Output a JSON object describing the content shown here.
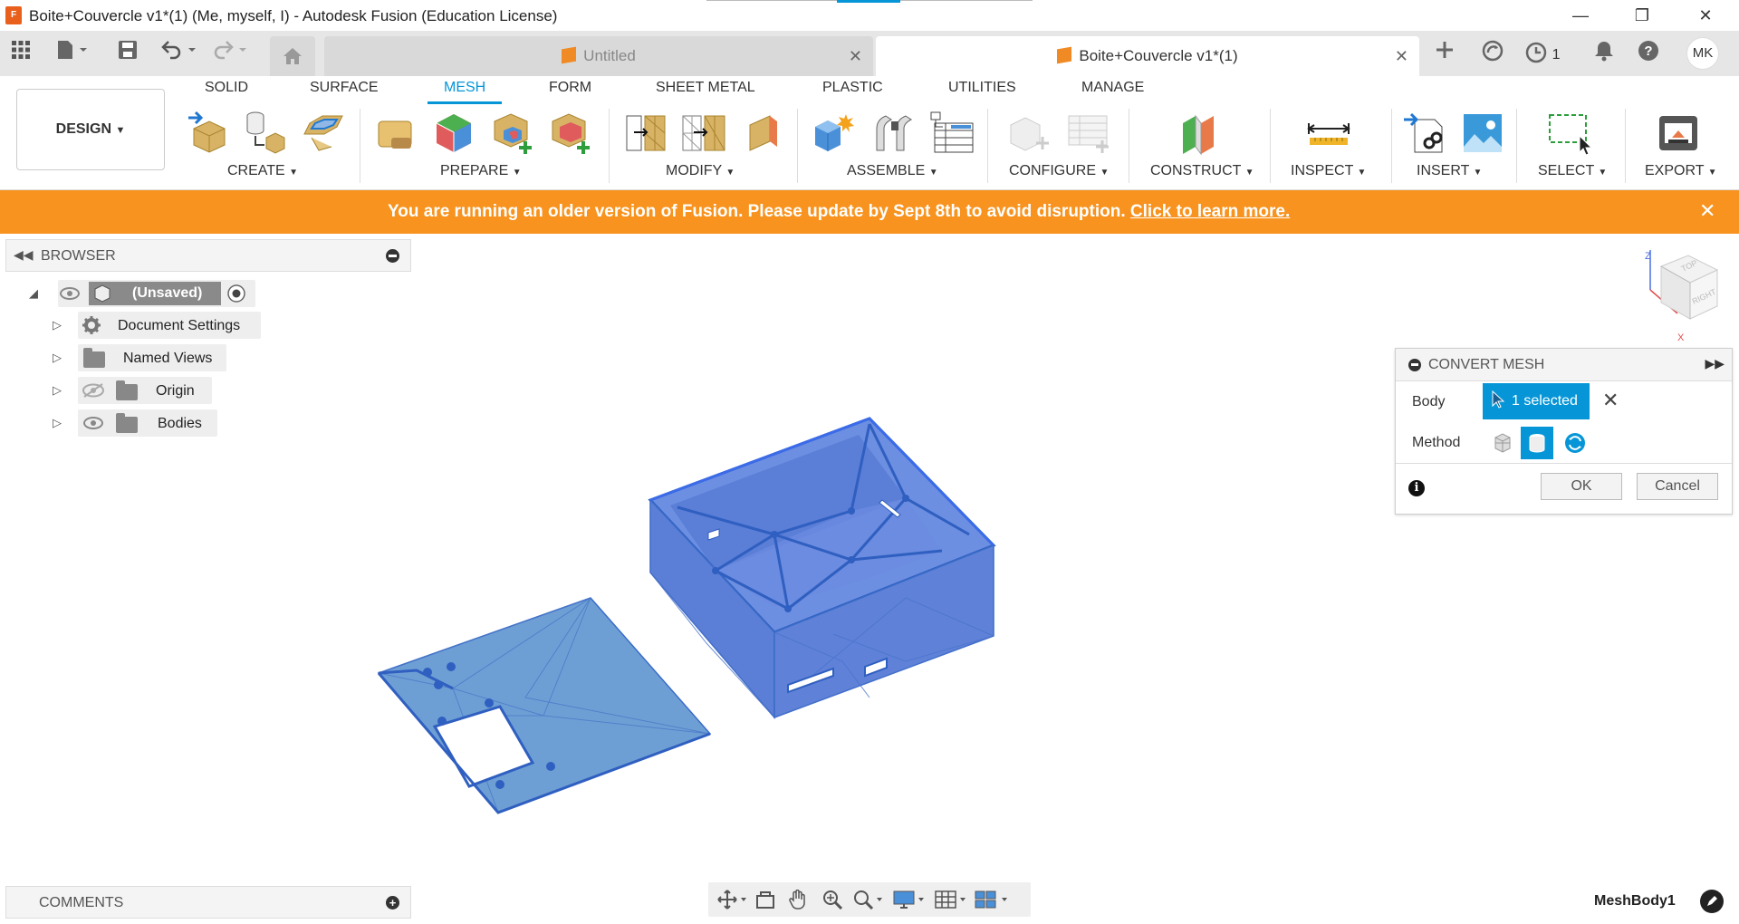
{
  "window": {
    "title": "Boite+Couvercle v1*(1) (Me, myself, I) - Autodesk Fusion (Education License)",
    "app_icon_letter": "F",
    "controls": {
      "minimize": "—",
      "restore": "❐",
      "close": "✕"
    }
  },
  "tabs": [
    {
      "label": "Untitled",
      "active": false
    },
    {
      "label": "Boite+Couvercle v1*(1)",
      "active": true
    }
  ],
  "tabbar_right": {
    "jobs_count": "1",
    "user_initials": "MK"
  },
  "workspace": {
    "mode_label": "DESIGN",
    "tabs": [
      "SOLID",
      "SURFACE",
      "MESH",
      "FORM",
      "SHEET METAL",
      "PLASTIC",
      "UTILITIES",
      "MANAGE"
    ],
    "active_tab": "MESH",
    "groups": [
      "CREATE",
      "PREPARE",
      "MODIFY",
      "ASSEMBLE",
      "CONFIGURE",
      "CONSTRUCT",
      "INSPECT",
      "INSERT",
      "SELECT",
      "EXPORT"
    ]
  },
  "banner": {
    "text": "You are running an older version of Fusion. Please update by Sept 8th to avoid disruption.",
    "link": "Click to learn more.",
    "color": "#f7931e"
  },
  "browser": {
    "title": "BROWSER",
    "root": "(Unsaved)",
    "items": [
      "Document Settings",
      "Named Views",
      "Origin",
      "Bodies"
    ]
  },
  "comments": {
    "title": "COMMENTS"
  },
  "convert_mesh": {
    "title": "CONVERT MESH",
    "body_label": "Body",
    "body_value": "1 selected",
    "method_label": "Method",
    "ok": "OK",
    "cancel": "Cancel"
  },
  "viewcube": {
    "top": "TOP",
    "right": "RIGHT",
    "axis_z": "Z",
    "axis_x": "X"
  },
  "status": {
    "active_body": "MeshBody1"
  },
  "colors": {
    "accent": "#0696d7",
    "mesh_fill": "#5b7fd6",
    "lid_fill": "#6e9fd4"
  }
}
